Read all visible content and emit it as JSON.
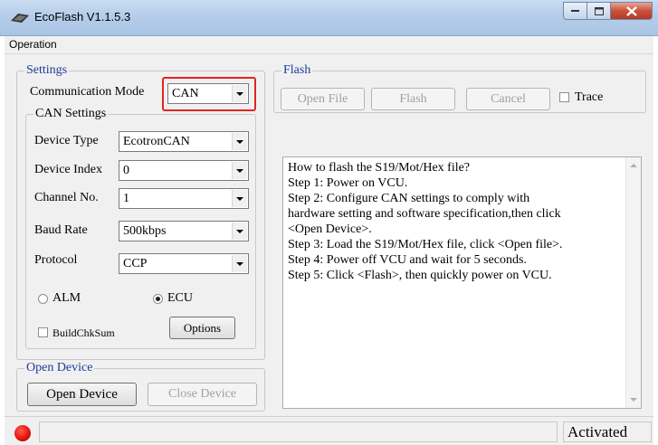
{
  "window": {
    "title": "EcoFlash V1.1.5.3",
    "app_icon": "eco-flash-icon"
  },
  "menu": {
    "operation": "Operation"
  },
  "settings": {
    "legend": "Settings",
    "comm_mode_label": "Communication Mode",
    "comm_mode_value": "CAN",
    "can_legend": "CAN Settings",
    "device_type_label": "Device Type",
    "device_type_value": "EcotronCAN",
    "device_index_label": "Device Index",
    "device_index_value": "0",
    "channel_label": "Channel No.",
    "channel_value": "1",
    "baud_label": "Baud Rate",
    "baud_value": "500kbps",
    "protocol_label": "Protocol",
    "protocol_value": "CCP",
    "alm_label": "ALM",
    "ecu_label": "ECU",
    "selected_target": "ECU",
    "buildchk_label": "BuildChkSum",
    "options_label": "Options"
  },
  "open_device": {
    "legend": "Open Device",
    "open_label": "Open Device",
    "close_label": "Close Device"
  },
  "flash": {
    "legend": "Flash",
    "open_file_label": "Open File",
    "flash_label": "Flash",
    "cancel_label": "Cancel",
    "trace_label": "Trace"
  },
  "log": {
    "lines": [
      "How to flash the S19/Mot/Hex file?",
      "Step 1: Power on VCU.",
      "Step 2: Configure CAN settings to comply with",
      "hardware setting and software specification,then click",
      "<Open Device>.",
      "Step 3: Load the S19/Mot/Hex file, click <Open file>.",
      "Step 4: Power off VCU and wait for 5 seconds.",
      "Step 5: Click <Flash>, then quickly power on VCU."
    ]
  },
  "status": {
    "main": "",
    "activation": "Activated",
    "led_color": "#e0100a"
  },
  "colors": {
    "highlight": "#e0251f",
    "legend_blue": "#1c3c9c"
  }
}
